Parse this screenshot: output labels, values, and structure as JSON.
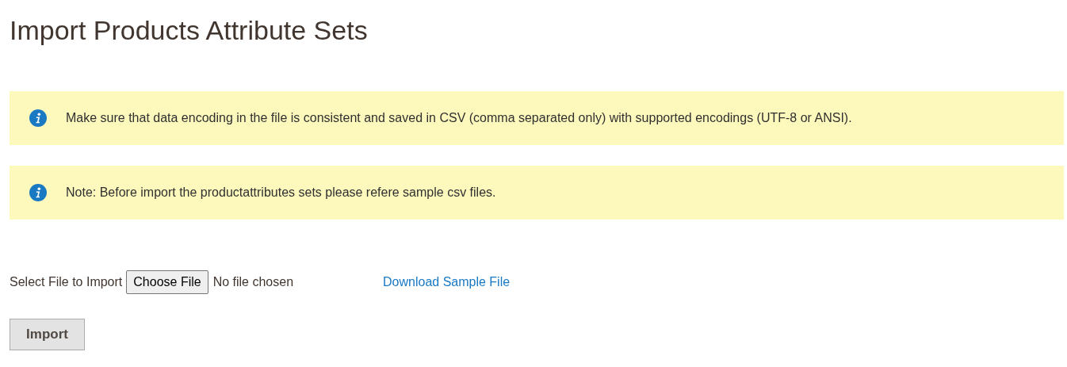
{
  "page_title": "Import Products Attribute Sets",
  "messages": [
    {
      "text": "Make sure that data encoding in the file is consistent and saved in CSV (comma separated only) with supported encodings (UTF-8 or ANSI)."
    },
    {
      "text": "Note: Before import the productattributes sets please refere sample csv files."
    }
  ],
  "file_field": {
    "label": "Select File to Import",
    "button": "Choose File",
    "status": "No file chosen"
  },
  "sample_link": "Download Sample File",
  "import_button": "Import"
}
